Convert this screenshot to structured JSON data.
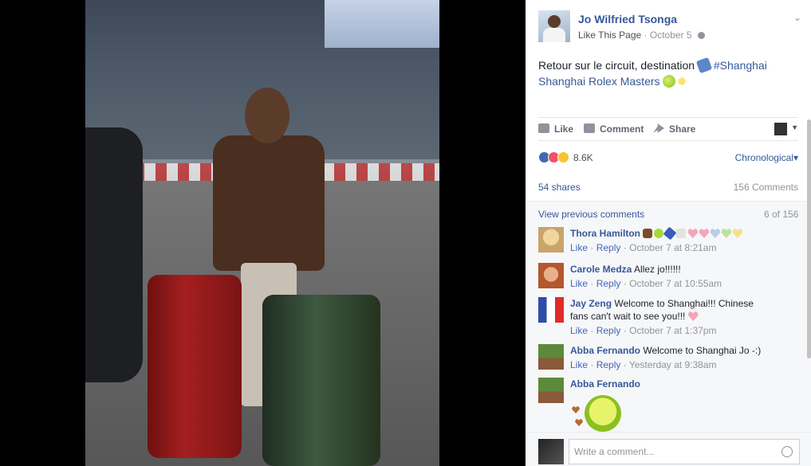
{
  "post": {
    "page_name": "Jo Wilfried Tsonga",
    "like_page": "Like This Page",
    "separator": "·",
    "date": "October 5",
    "text_lead": "Retour sur le circuit, destination",
    "hashtag": "#Shanghai",
    "text_tail": "Shanghai Rolex Masters"
  },
  "actions": {
    "like": "Like",
    "comment": "Comment",
    "share": "Share"
  },
  "reactions": {
    "count": "8.6K",
    "order_label": "Chronological",
    "order_caret": "▾",
    "shares": "54 shares",
    "comments_count": "156 Comments"
  },
  "comments": {
    "view_previous": "View previous comments",
    "pager": "6 of 156",
    "items": [
      {
        "name": "Thora Hamilton",
        "text": "",
        "like": "Like",
        "reply": "Reply",
        "dot": "·",
        "time": "October 7 at 8:21am"
      },
      {
        "name": "Carole Medza",
        "text": "Allez jo!!!!!!",
        "like": "Like",
        "reply": "Reply",
        "dot": "·",
        "time": "October 7 at 10:55am"
      },
      {
        "name": "Jay Zeng",
        "text": "Welcome to Shanghai!!! Chinese fans can't wait to see you!!!",
        "like": "Like",
        "reply": "Reply",
        "dot": "·",
        "time": "October 7 at 1:37pm"
      },
      {
        "name": "Abba Fernando",
        "text": "Welcome to Shanghai Jo -:)",
        "like": "Like",
        "reply": "Reply",
        "dot": "·",
        "time": "Yesterday at 9:38am"
      },
      {
        "name": "Abba Fernando",
        "text": ""
      }
    ]
  },
  "composer": {
    "placeholder": "Write a comment..."
  }
}
